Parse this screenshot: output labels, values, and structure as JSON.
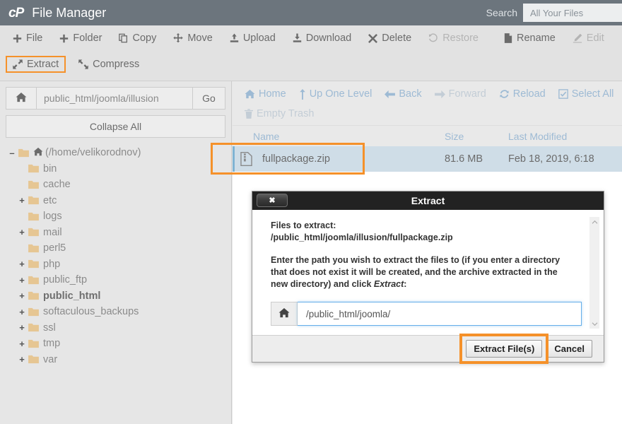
{
  "header": {
    "logo": "cP",
    "title": "File Manager",
    "search_label": "Search",
    "search_placeholder": "All Your Files",
    "bar_color": "#6c757d"
  },
  "toolbar": {
    "accent_highlight": "#f5912a",
    "row1": [
      {
        "label": "File",
        "icon": "plus-icon",
        "disabled": false
      },
      {
        "label": "Folder",
        "icon": "plus-icon",
        "disabled": false
      },
      {
        "label": "Copy",
        "icon": "copy-icon",
        "disabled": false
      },
      {
        "label": "Move",
        "icon": "move-icon",
        "disabled": false
      },
      {
        "label": "Upload",
        "icon": "upload-icon",
        "disabled": false
      },
      {
        "label": "Download",
        "icon": "download-icon",
        "disabled": false
      },
      {
        "label": "Delete",
        "icon": "x-icon",
        "disabled": false
      },
      {
        "label": "Restore",
        "icon": "restore-icon",
        "disabled": true
      },
      {
        "label": "Rename",
        "icon": "file-icon",
        "disabled": false
      },
      {
        "label": "Edit",
        "icon": "pencil-icon",
        "disabled": true
      },
      {
        "label": "",
        "icon": "html-editor-icon",
        "disabled": true
      }
    ],
    "row2": [
      {
        "label": "Extract",
        "icon": "extract-icon",
        "highlighted": true
      },
      {
        "label": "Compress",
        "icon": "compress-icon",
        "highlighted": false
      }
    ]
  },
  "sidebar": {
    "path_value": "public_html/joomla/illusion",
    "go_label": "Go",
    "home_icon": "home-icon",
    "collapse_all_label": "Collapse All",
    "tree": [
      {
        "label": "(/home/velikorodnov)",
        "toggle": "minus",
        "depth": 0,
        "root": true,
        "bold": false
      },
      {
        "label": "bin",
        "toggle": "none",
        "depth": 1,
        "root": false,
        "bold": false
      },
      {
        "label": "cache",
        "toggle": "none",
        "depth": 1,
        "root": false,
        "bold": false
      },
      {
        "label": "etc",
        "toggle": "plus",
        "depth": 1,
        "root": false,
        "bold": false
      },
      {
        "label": "logs",
        "toggle": "none",
        "depth": 1,
        "root": false,
        "bold": false
      },
      {
        "label": "mail",
        "toggle": "plus",
        "depth": 1,
        "root": false,
        "bold": false
      },
      {
        "label": "perl5",
        "toggle": "none",
        "depth": 1,
        "root": false,
        "bold": false
      },
      {
        "label": "php",
        "toggle": "plus",
        "depth": 1,
        "root": false,
        "bold": false
      },
      {
        "label": "public_ftp",
        "toggle": "plus",
        "depth": 1,
        "root": false,
        "bold": false
      },
      {
        "label": "public_html",
        "toggle": "plus",
        "depth": 1,
        "root": false,
        "bold": true
      },
      {
        "label": "softaculous_backups",
        "toggle": "plus",
        "depth": 1,
        "root": false,
        "bold": false
      },
      {
        "label": "ssl",
        "toggle": "plus",
        "depth": 1,
        "root": false,
        "bold": false
      },
      {
        "label": "tmp",
        "toggle": "plus",
        "depth": 1,
        "root": false,
        "bold": false
      },
      {
        "label": "var",
        "toggle": "plus",
        "depth": 1,
        "root": false,
        "bold": false
      }
    ]
  },
  "filelist": {
    "nav_row1": [
      {
        "label": "Home",
        "icon": "home-icon",
        "muted": false
      },
      {
        "label": "Up One Level",
        "icon": "up-arrow-icon",
        "muted": false
      },
      {
        "label": "Back",
        "icon": "arrow-left-icon",
        "muted": false
      },
      {
        "label": "Forward",
        "icon": "arrow-right-icon",
        "muted": true
      },
      {
        "label": "Reload",
        "icon": "reload-icon",
        "muted": false
      },
      {
        "label": "Select All",
        "icon": "checkbox-icon",
        "muted": false
      }
    ],
    "nav_row2": [
      {
        "label": "Empty Trash",
        "icon": "trash-icon",
        "muted": true
      }
    ],
    "columns": {
      "name": "Name",
      "size": "Size",
      "modified": "Last Modified"
    },
    "rows": [
      {
        "name": "fullpackage.zip",
        "size": "81.6 MB",
        "modified": "Feb 18, 2019, 6:18",
        "icon": "zip-file-icon",
        "selected": true,
        "highlighted": true
      }
    ]
  },
  "dialog": {
    "title": "Extract",
    "close_label": "✖",
    "files_label": "Files to extract:",
    "files_path": "/public_html/joomla/illusion/fullpackage.zip",
    "instructions_before": "Enter the path you wish to extract the files to (if you enter a directory that does not exist it will be created, and the archive extracted in the new directory) and click ",
    "instructions_em": "Extract",
    "instructions_after": ":",
    "path_input_value": "/public_html/joomla/",
    "home_icon": "home-icon",
    "scroll_up_icon": "chevron-up-icon",
    "scroll_down_icon": "chevron-down-icon",
    "extract_button": "Extract File(s)",
    "cancel_button": "Cancel",
    "extract_button_highlighted": true
  }
}
